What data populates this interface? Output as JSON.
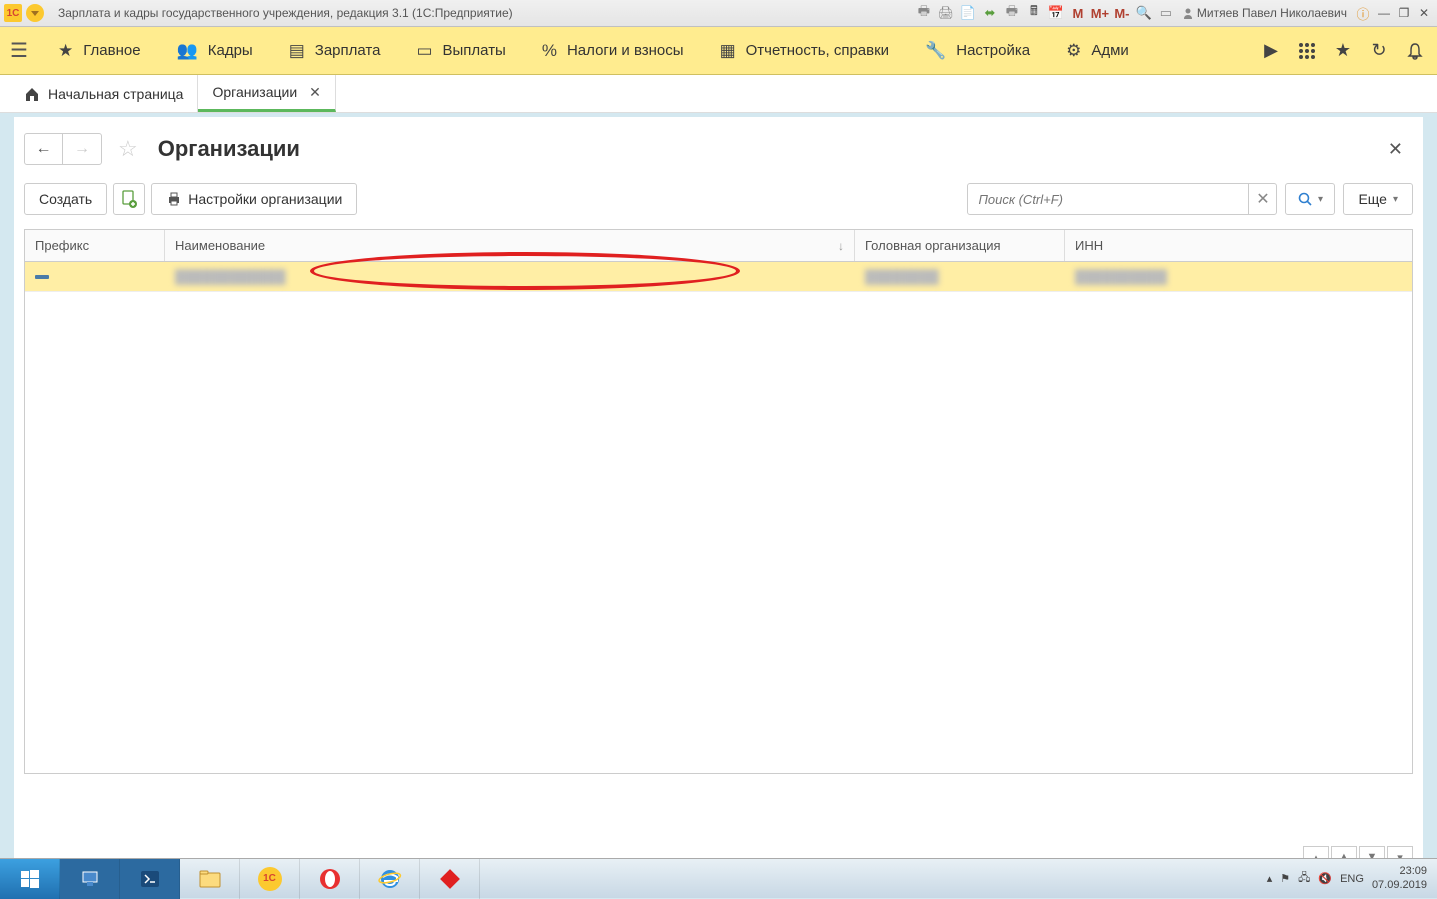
{
  "titlebar": {
    "title": "Зарплата и кадры государственного учреждения, редакция 3.1  (1С:Предприятие)",
    "user": "Митяев Павел Николаевич"
  },
  "mainmenu": {
    "items": [
      {
        "label": "Главное",
        "icon": "star"
      },
      {
        "label": "Кадры",
        "icon": "people"
      },
      {
        "label": "Зарплата",
        "icon": "list"
      },
      {
        "label": "Выплаты",
        "icon": "card"
      },
      {
        "label": "Налоги и взносы",
        "icon": "percent"
      },
      {
        "label": "Отчетность, справки",
        "icon": "doc"
      },
      {
        "label": "Настройка",
        "icon": "wrench"
      },
      {
        "label": "Адми",
        "icon": "gear"
      }
    ]
  },
  "tabs": {
    "home": "Начальная страница",
    "active": "Организации"
  },
  "page": {
    "title": "Организации"
  },
  "toolbar": {
    "create": "Создать",
    "settings": "Настройки организации",
    "search_placeholder": "Поиск (Ctrl+F)",
    "more": "Еще"
  },
  "table": {
    "columns": {
      "prefix": "Префикс",
      "name": "Наименование",
      "parent": "Головная организация",
      "inn": "ИНН"
    },
    "rows": [
      {
        "prefix": "",
        "name": "",
        "parent": "",
        "inn": ""
      }
    ]
  },
  "taskbar": {
    "lang": "ENG",
    "time": "23:09",
    "date": "07.09.2019"
  }
}
